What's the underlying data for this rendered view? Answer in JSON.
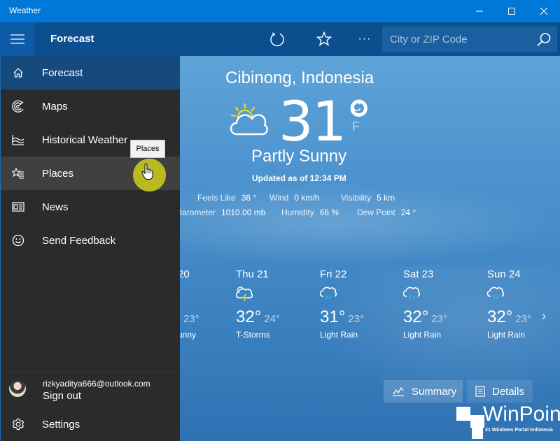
{
  "window": {
    "title": "Weather",
    "controls": [
      "minimize",
      "maximize",
      "close"
    ]
  },
  "appbar": {
    "page_title": "Forecast",
    "refresh_icon": "refresh-icon",
    "favorite_icon": "star-icon",
    "more_label": "···",
    "search": {
      "placeholder": "City or ZIP Code",
      "value": ""
    }
  },
  "sidebar": {
    "items": [
      {
        "label": "Forecast",
        "icon": "home-icon",
        "active": true
      },
      {
        "label": "Maps",
        "icon": "radar-icon"
      },
      {
        "label": "Historical Weather",
        "icon": "chart-waves-icon"
      },
      {
        "label": "Places",
        "icon": "star-list-icon",
        "hover": true
      },
      {
        "label": "News",
        "icon": "newspaper-icon"
      },
      {
        "label": "Send Feedback",
        "icon": "smiley-icon"
      }
    ],
    "account": {
      "email": "rizkyaditya666@outlook.com",
      "action": "Sign out"
    },
    "settings_label": "Settings"
  },
  "tooltip": "Places",
  "current": {
    "location": "Cibinong, Indonesia",
    "temperature": "31°",
    "unit_c": "C",
    "unit_f": "F",
    "condition": "Partly Sunny",
    "updated": "Updated as of 12:34 PM",
    "icon": "partly-sunny-icon",
    "details_row1": [
      {
        "label": "Feels Like",
        "value": "36 °"
      },
      {
        "label": "Wind",
        "value": "0 km/h"
      },
      {
        "label": "Visibility",
        "value": "5 km"
      }
    ],
    "details_row2": [
      {
        "label": "Barometer",
        "value": "1010.00 mb"
      },
      {
        "label": "Humidity",
        "value": "66 %"
      },
      {
        "label": "Dew Point",
        "value": "24 °"
      }
    ]
  },
  "daily": [
    {
      "day": "20",
      "high": "",
      "low": "23°",
      "desc": "unny",
      "icon": "partly-sunny-icon"
    },
    {
      "day": "Thu 21",
      "high": "32°",
      "low": "24°",
      "desc": "T-Storms",
      "icon": "thunderstorm-icon"
    },
    {
      "day": "Fri 22",
      "high": "31°",
      "low": "23°",
      "desc": "Light Rain",
      "icon": "light-rain-icon"
    },
    {
      "day": "Sat 23",
      "high": "32°",
      "low": "23°",
      "desc": "Light Rain",
      "icon": "light-rain-icon"
    },
    {
      "day": "Sun 24",
      "high": "32°",
      "low": "23°",
      "desc": "Light Rain",
      "icon": "light-rain-icon"
    }
  ],
  "tabs": {
    "summary": "Summary",
    "details": "Details"
  },
  "watermark": {
    "brand": "WinPoin",
    "tagline": "#1 Windows Portal Indonesia"
  },
  "colors": {
    "titlebar": "#0078d7",
    "appbar": "#0b4f8e",
    "sidebar": "#2b2b2b",
    "active_nav": "#174a7c",
    "sun": "#f2d21b",
    "rain": "#3fa9e6"
  }
}
